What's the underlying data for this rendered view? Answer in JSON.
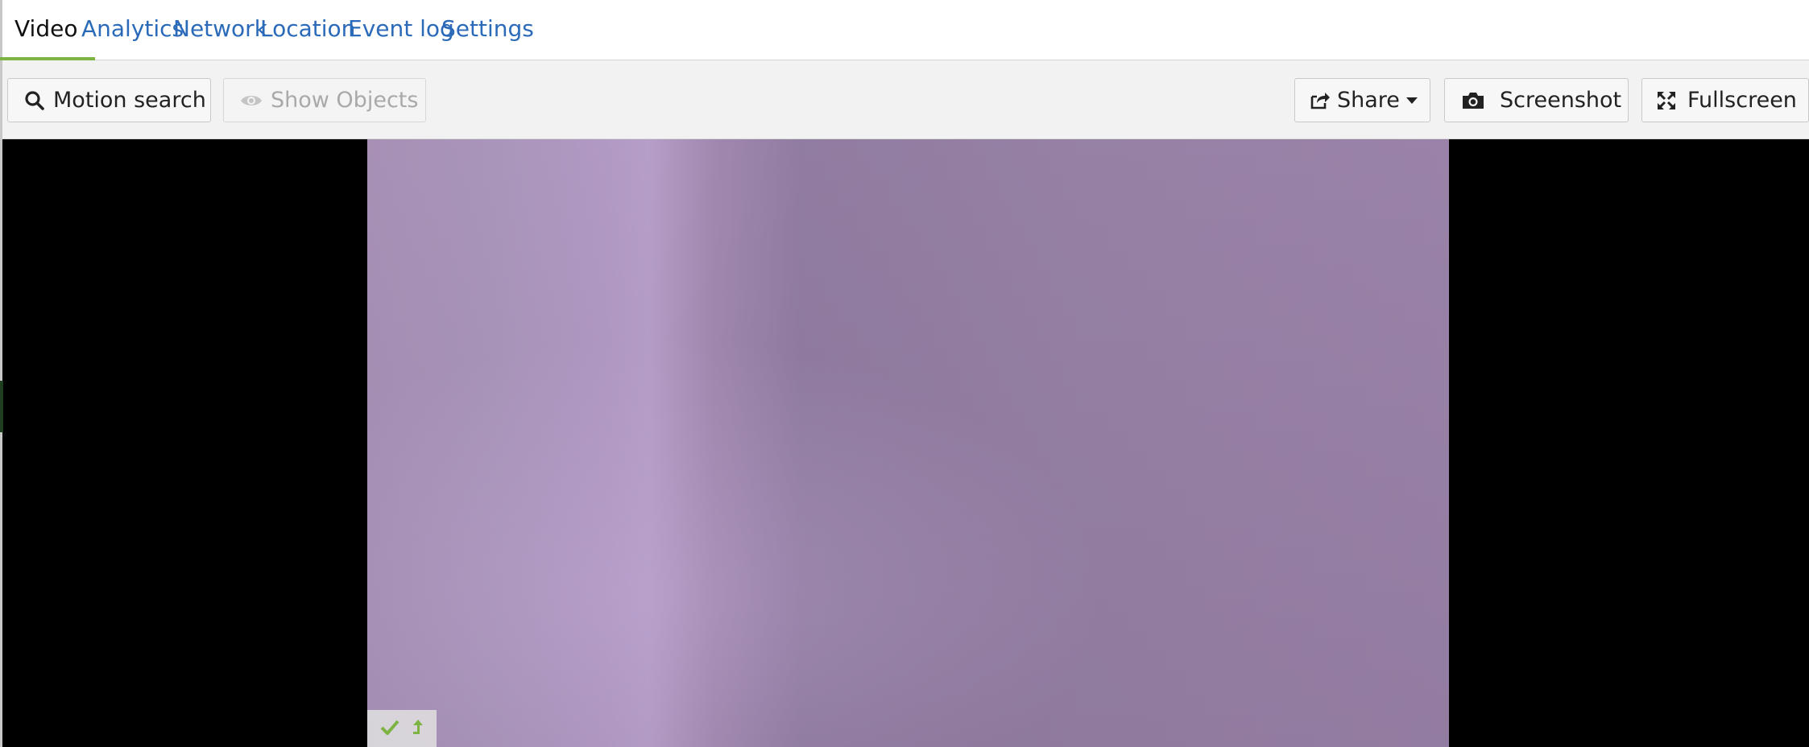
{
  "tabs": [
    {
      "label": "Video",
      "active": true
    },
    {
      "label": "Analytics",
      "active": false
    },
    {
      "label": "Network",
      "active": false
    },
    {
      "label": "Location",
      "active": false
    },
    {
      "label": "Event log",
      "active": false
    },
    {
      "label": "Settings",
      "active": false
    }
  ],
  "toolbar": {
    "motion_search": {
      "label": "Motion search",
      "icon": "search-icon"
    },
    "show_objects": {
      "label": "Show Objects",
      "icon": "eye-icon",
      "disabled": true
    },
    "share": {
      "label": "Share",
      "icon": "share-icon"
    },
    "screenshot": {
      "label": "Screenshot",
      "icon": "camera-icon"
    },
    "fullscreen": {
      "label": "Fullscreen",
      "icon": "expand-icon"
    }
  },
  "video": {
    "status_icons": [
      "check-icon",
      "upload-arrow-icon"
    ]
  },
  "colors": {
    "tab_link": "#2a6ab8",
    "active_tab_underline": "#7cb342",
    "status_green": "#7cb342",
    "stage_background": "#000000"
  }
}
